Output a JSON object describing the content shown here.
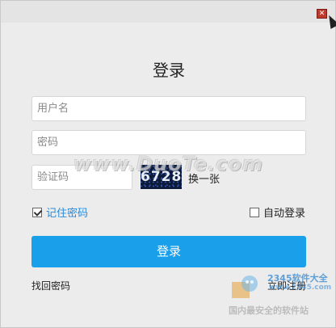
{
  "window": {
    "close_symbol": "✕"
  },
  "login": {
    "title": "登录",
    "username_placeholder": "用户名",
    "password_placeholder": "密码",
    "captcha_placeholder": "验证码",
    "captcha_text": "6728",
    "refresh_label": "换一张",
    "remember_label": "记住密码",
    "remember_checked": true,
    "autologin_label": "自动登录",
    "autologin_checked": false,
    "submit_label": "登录",
    "forgot_label": "找回密码",
    "register_label": "立即注册"
  },
  "watermarks": {
    "center": "www.DuoTe.com",
    "site_name": "2345软件大全",
    "site_url": "www.2345.com",
    "footer": "国内最安全的软件站"
  },
  "colors": {
    "accent": "#1aa0ea",
    "link": "#2a8ad8",
    "close": "#c0392b"
  },
  "icons": {
    "close": "close-icon",
    "cursor": "mouse-cursor-icon",
    "checkbox": "checkbox-icon"
  }
}
